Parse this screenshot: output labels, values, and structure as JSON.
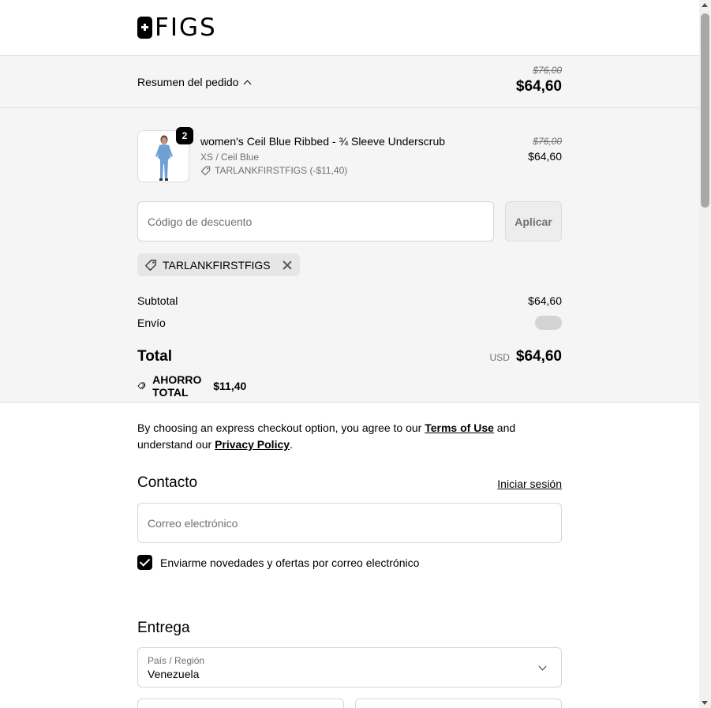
{
  "brand": {
    "logo_text": "FIGS"
  },
  "summary": {
    "toggle_label": "Resumen del pedido",
    "original_price": "$76,00",
    "price": "$64,60"
  },
  "item": {
    "quantity": "2",
    "name": "women's Ceil Blue Ribbed - ¾ Sleeve Underscrub",
    "variant": "XS / Ceil Blue",
    "discount": "TARLANKFIRSTFIGS (-$11,40)",
    "original_price": "$76,00",
    "price": "$64,60"
  },
  "discount": {
    "placeholder": "Código de descuento",
    "apply_label": "Aplicar",
    "applied_code": "TARLANKFIRSTFIGS"
  },
  "totals": {
    "subtotal_label": "Subtotal",
    "subtotal_value": "$64,60",
    "shipping_label": "Envío",
    "total_label": "Total",
    "currency": "USD",
    "total_value": "$64,60",
    "savings_label": "AHORRO TOTAL",
    "savings_value": "$11,40"
  },
  "express": {
    "text_before": "By choosing an express checkout option, you agree to our ",
    "terms_link": "Terms of Use",
    "text_middle": " and understand our ",
    "privacy_link": "Privacy Policy",
    "text_after": "."
  },
  "contact": {
    "title": "Contacto",
    "login_link": "Iniciar sesión",
    "email_placeholder": "Correo electrónico",
    "newsletter_label": "Enviarme novedades y ofertas por correo electrónico",
    "newsletter_checked": true
  },
  "delivery": {
    "title": "Entrega",
    "country_label": "País / Región",
    "country_value": "Venezuela"
  },
  "colors": {
    "summary_background": "#f5f5f5",
    "accent": "#000000",
    "muted_text": "#707070"
  }
}
